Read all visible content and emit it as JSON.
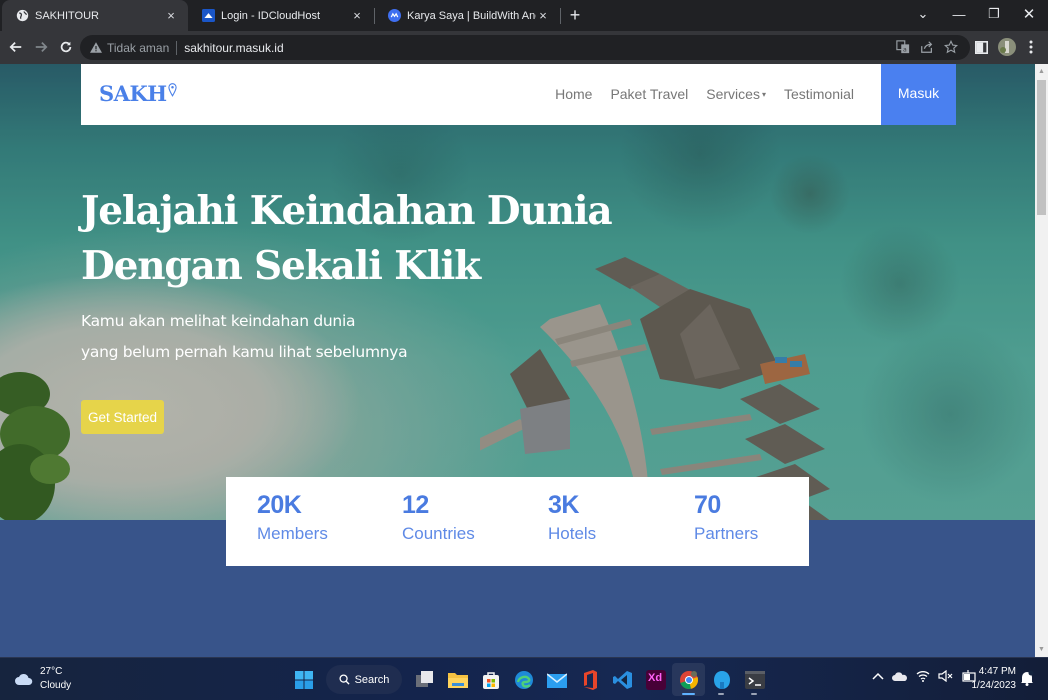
{
  "browser": {
    "tabs": [
      {
        "title": "SAKHITOUR",
        "favicon": "globe-icon",
        "active": true
      },
      {
        "title": "Login - IDCloudHost",
        "favicon": "idcloudhost-icon",
        "active": false
      },
      {
        "title": "Karya Saya | BuildWith Angga",
        "favicon": "buildwithangga-icon",
        "active": false
      }
    ],
    "close_glyph": "×",
    "new_tab_glyph": "+",
    "security_label": "Tidak aman",
    "url": "sakhitour.masuk.id",
    "window_controls": {
      "tab_search": "⌄",
      "minimize": "—",
      "restore": "❐",
      "close": "✕"
    }
  },
  "page": {
    "brand": "SAKH",
    "nav": {
      "links": [
        "Home",
        "Paket Travel",
        "Services",
        "Testimonial"
      ],
      "dropdown_caret": "▾",
      "login_button": "Masuk"
    },
    "hero": {
      "title_line1": "Jelajahi Keindahan Dunia",
      "title_line2": "Dengan Sekali Klik",
      "subtitle_line1": "Kamu akan melihat keindahan dunia",
      "subtitle_line2": "yang belum pernah kamu lihat sebelumnya",
      "cta": "Get Started"
    },
    "stats": [
      {
        "value": "20K",
        "label": "Members"
      },
      {
        "value": "12",
        "label": "Countries"
      },
      {
        "value": "3K",
        "label": "Hotels"
      },
      {
        "value": "70",
        "label": "Partners"
      }
    ],
    "colors": {
      "primary": "#4a80f0",
      "cta": "#e6d44a",
      "section_bg": "#38548a"
    }
  },
  "taskbar": {
    "weather": {
      "temp": "27°C",
      "condition": "Cloudy"
    },
    "search_label": "Search",
    "apps": [
      "task-view",
      "file-explorer",
      "microsoft-store",
      "edge",
      "mail",
      "office",
      "vscode",
      "adobe-xd",
      "chrome",
      "app-bird",
      "terminal"
    ],
    "xd_label": "Xd",
    "clock": {
      "time": "4:47 PM",
      "date": "1/24/2023"
    }
  }
}
